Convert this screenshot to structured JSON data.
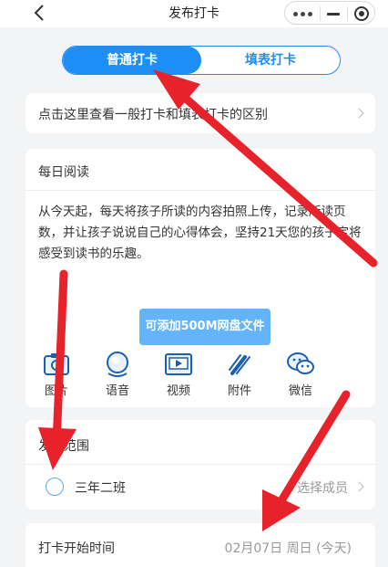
{
  "nav": {
    "title": "发布打卡",
    "back_icon": "chevron-left-icon",
    "capsule_icons": [
      "more-dots-icon",
      "minimize-icon",
      "close-target-icon"
    ]
  },
  "tabs": {
    "active": "普通打卡",
    "inactive": "填表打卡"
  },
  "info_link": {
    "label": "点击这里查看一般打卡和填表打卡的区别"
  },
  "content": {
    "title": "每日阅读",
    "description": "从今天起，每天将孩子所读的内容拍照上传，记录所读页数，并让孩子说说自己的心得体会，坚持21天您的孩子定将感受到读书的乐趣。",
    "upload_button": "可添加500M网盘文件",
    "tools": [
      {
        "label": "图片",
        "icon": "image-icon"
      },
      {
        "label": "语音",
        "icon": "microphone-icon"
      },
      {
        "label": "视频",
        "icon": "video-icon"
      },
      {
        "label": "附件",
        "icon": "attachment-icon"
      },
      {
        "label": "微信",
        "icon": "wechat-icon"
      }
    ]
  },
  "scope": {
    "title": "发布范围",
    "class_name": "三年二班",
    "select_members": "选择成员"
  },
  "start_time": {
    "label": "打卡开始时间",
    "value": "02月07日 周日 (今天)"
  },
  "colors": {
    "primary": "#1e8ef7",
    "upload_button": "#63b4fb",
    "annotation_arrow": "#e8222a"
  }
}
